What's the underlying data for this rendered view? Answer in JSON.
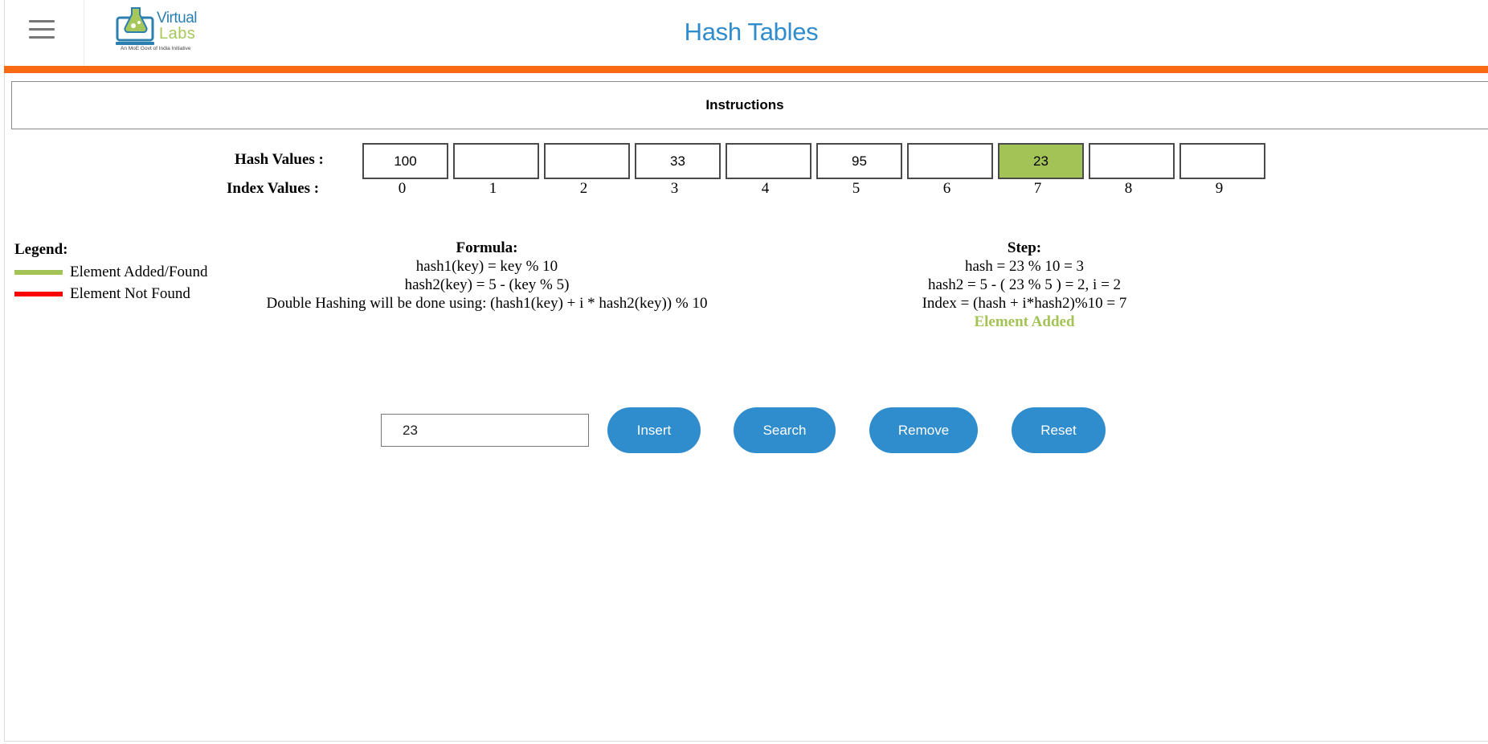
{
  "header": {
    "title": "Hash Tables",
    "logo_word1": "Virtual",
    "logo_word2": "Labs",
    "logo_tagline": "An MoE Govt of India Initiative"
  },
  "instructions": {
    "label": "Instructions"
  },
  "table": {
    "hash_label": "Hash Values :",
    "index_label": "Index Values :",
    "cells": [
      {
        "value": "100",
        "index": "0",
        "state": "normal"
      },
      {
        "value": "",
        "index": "1",
        "state": "normal"
      },
      {
        "value": "",
        "index": "2",
        "state": "normal"
      },
      {
        "value": "33",
        "index": "3",
        "state": "normal"
      },
      {
        "value": "",
        "index": "4",
        "state": "normal"
      },
      {
        "value": "95",
        "index": "5",
        "state": "normal"
      },
      {
        "value": "",
        "index": "6",
        "state": "normal"
      },
      {
        "value": "23",
        "index": "7",
        "state": "found"
      },
      {
        "value": "",
        "index": "8",
        "state": "normal"
      },
      {
        "value": "",
        "index": "9",
        "state": "normal"
      }
    ]
  },
  "legend": {
    "title": "Legend:",
    "added_label": "Element Added/Found",
    "not_found_label": "Element Not Found",
    "added_color": "#a3c356",
    "not_found_color": "#ff0000"
  },
  "formula": {
    "title": "Formula:",
    "line1": "hash1(key) = key % 10",
    "line2": "hash2(key) = 5 - (key % 5)",
    "line3": "Double Hashing will be done using: (hash1(key) + i * hash2(key)) % 10"
  },
  "step": {
    "title": "Step:",
    "line1": "hash = 23 % 10 = 3",
    "line2": "hash2 = 5 - ( 23 % 5 ) = 2, i = 2",
    "line3": "Index = (hash + i*hash2)%10 = 7",
    "result": "Element Added"
  },
  "controls": {
    "input_value": "23",
    "insert_label": "Insert",
    "search_label": "Search",
    "remove_label": "Remove",
    "reset_label": "Reset"
  },
  "colors": {
    "accent": "#2f8ccd",
    "brand_bar": "#f96a12"
  }
}
